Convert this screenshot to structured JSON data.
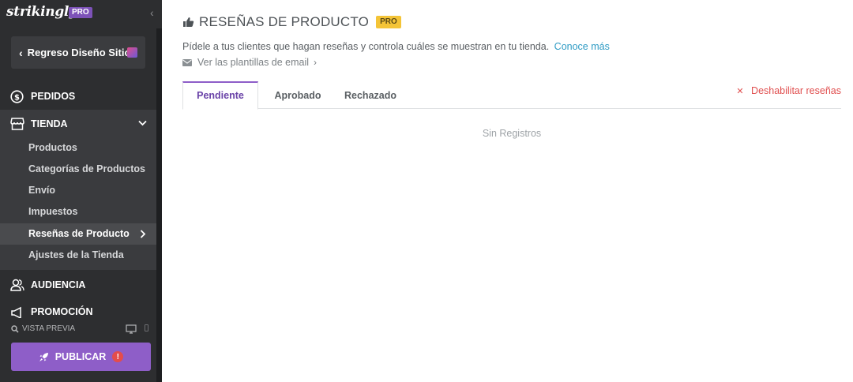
{
  "sidebar": {
    "logo": "strikingly",
    "pro_tag": "PRO",
    "back_label": "Regreso Diseño Sitio",
    "nav": {
      "pedidos": "PEDIDOS",
      "tienda": "TIENDA",
      "audiencia": "AUDIENCIA",
      "promocion": "PROMOCIÓN"
    },
    "tienda_items": [
      {
        "label": "Productos"
      },
      {
        "label": "Categorías de Productos"
      },
      {
        "label": "Envío"
      },
      {
        "label": "Impuestos"
      },
      {
        "label": "Reseñas de Producto"
      },
      {
        "label": "Ajustes de la Tienda"
      }
    ],
    "preview_label": "VISTA PREVIA",
    "publish_label": "PUBLICAR",
    "publish_alert": "!"
  },
  "main": {
    "title": "RESEÑAS DE PRODUCTO",
    "pro_badge": "PRO",
    "description": "Pídele a tus clientes que hagan reseñas y controla cuáles se muestran en tu tienda.",
    "learn_more": "Conoce más",
    "email_templates": "Ver las plantillas de email",
    "tabs": [
      {
        "label": "Pendiente",
        "active": true
      },
      {
        "label": "Aprobado",
        "active": false
      },
      {
        "label": "Rechazado",
        "active": false
      }
    ],
    "disable_reviews": "Deshabilitar reseñas",
    "empty_state": "Sin Registros"
  },
  "colors": {
    "sidebar_bg": "#2d2e30",
    "accent_purple": "#8e5ec8",
    "link_blue": "#2e9bc4",
    "danger_red": "#e04f4f",
    "pro_yellow": "#f4c437"
  }
}
